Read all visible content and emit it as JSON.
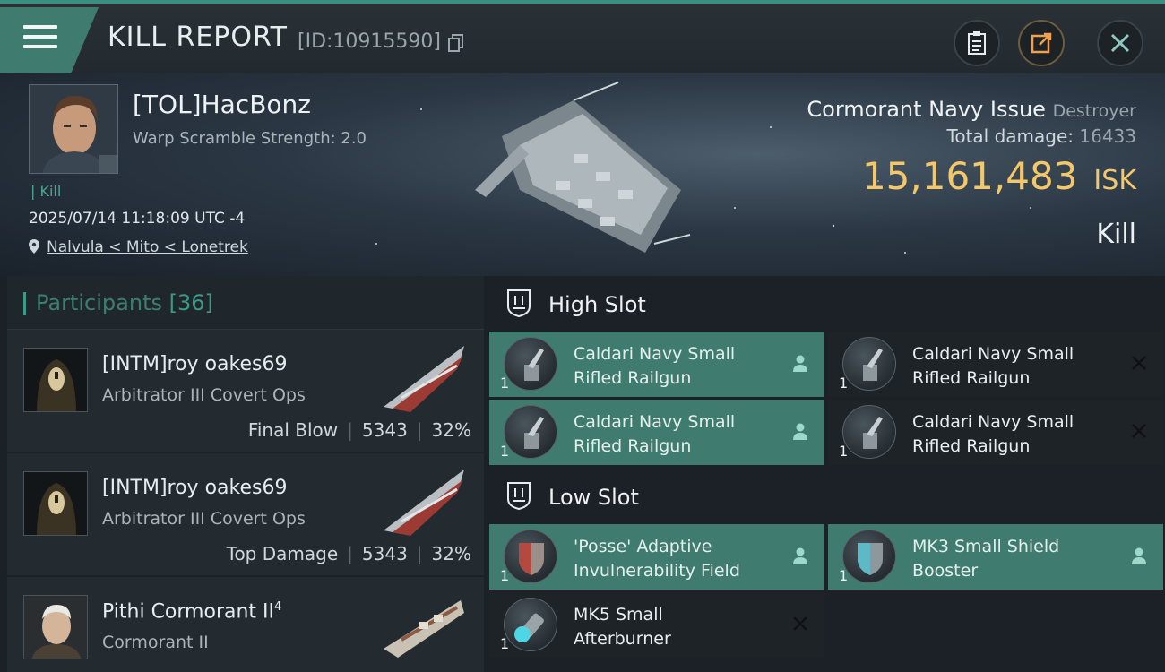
{
  "header": {
    "title": "KILL REPORT",
    "report_id": "[ID:10915590]",
    "buttons": {
      "clipboard": "clipboard-icon",
      "share": "share-icon",
      "close": "close-icon"
    }
  },
  "victim": {
    "name": "[TOL]HacBonz",
    "warp_scramble": "Warp Scramble Strength: 2.0",
    "kill_type": "Kill",
    "date": "2025/07/14 11:18:09 UTC -4",
    "location": "Nalvula < Mito < Lonetrek",
    "ship_name": "Cormorant Navy Issue",
    "ship_class": "Destroyer",
    "total_damage_label": "Total damage:",
    "total_damage": "16433",
    "isk_value": "15,161,483",
    "isk_unit": "ISK",
    "result": "Kill"
  },
  "participants": {
    "title": "Participants",
    "count": "[36]",
    "rows": [
      {
        "name": "[INTM]roy oakes69",
        "ship": "Arbitrator III Covert Ops",
        "role": "Final Blow",
        "damage": "5343",
        "percent": "32%"
      },
      {
        "name": "[INTM]roy oakes69",
        "ship": "Arbitrator III Covert Ops",
        "role": "Top Damage",
        "damage": "5343",
        "percent": "32%"
      },
      {
        "name": "Pithi Cormorant II",
        "sup": "4",
        "ship": "Cormorant II"
      }
    ]
  },
  "fitting": {
    "high_slot": {
      "title": "High Slot",
      "modules": [
        {
          "line1": "Caldari Navy Small",
          "line2": "Rifled Railgun",
          "qty": "1",
          "status": "fitted"
        },
        {
          "line1": "Caldari Navy Small",
          "line2": "Rifled Railgun",
          "qty": "1",
          "status": "destroyed"
        },
        {
          "line1": "Caldari Navy Small",
          "line2": "Rifled Railgun",
          "qty": "1",
          "status": "fitted"
        },
        {
          "line1": "Caldari Navy Small",
          "line2": "Rifled Railgun",
          "qty": "1",
          "status": "destroyed"
        }
      ]
    },
    "low_slot": {
      "title": "Low Slot",
      "modules": [
        {
          "line1": "'Posse' Adaptive",
          "line2": "Invulnerability Field",
          "qty": "1",
          "status": "fitted"
        },
        {
          "line1": "MK3 Small Shield",
          "line2": "Booster",
          "qty": "1",
          "status": "fitted"
        },
        {
          "line1": "MK5 Small",
          "line2": "Afterburner",
          "qty": "1",
          "status": "destroyed"
        }
      ]
    }
  }
}
